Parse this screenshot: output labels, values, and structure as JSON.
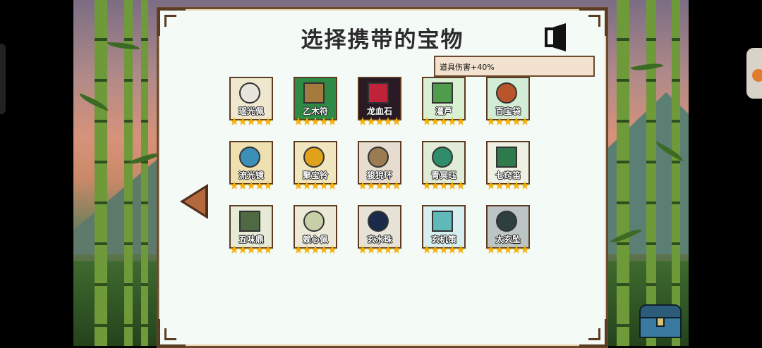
{
  "dialog": {
    "title": "选择携带的宝物",
    "tooltip": "道具伤害+40%"
  },
  "icons": {
    "exit": "exit-door-icon",
    "prev": "arrow-left-icon",
    "chest": "treasure-chest-icon",
    "star": "star-icon"
  },
  "colors": {
    "panel_bg": "#f4faf6",
    "frame": "#5a3c22",
    "star": "#f3b10c",
    "arrow": "#b4683e"
  },
  "items": [
    {
      "name": "瑶光佩",
      "stars": 5,
      "bg": "#efe8cf",
      "art": "#e8e6dc",
      "round": true
    },
    {
      "name": "乙木符",
      "stars": 5,
      "bg": "#2f8a45",
      "art": "#a57a3f",
      "round": false
    },
    {
      "name": "龙血石",
      "stars": 5,
      "bg": "#2a1a26",
      "art": "#c0223a",
      "round": false
    },
    {
      "name": "灌芦",
      "stars": 5,
      "bg": "#d9f0d3",
      "art": "#4f9c4a",
      "round": false
    },
    {
      "name": "百宝袋",
      "stars": 5,
      "bg": "#d3ecd6",
      "art": "#b8552a",
      "round": true
    },
    {
      "name": "流光镜",
      "stars": 5,
      "bg": "#efe0b2",
      "art": "#3c8fb6",
      "round": true
    },
    {
      "name": "聚宝铃",
      "stars": 5,
      "bg": "#f0e6bf",
      "art": "#e0a21a",
      "round": true
    },
    {
      "name": "狻猊环",
      "stars": 5,
      "bg": "#e6ddd0",
      "art": "#9a7b52",
      "round": true
    },
    {
      "name": "青冥珏",
      "stars": 5,
      "bg": "#e0ecd8",
      "art": "#2f8d6a",
      "round": true
    },
    {
      "name": "七窍笛",
      "stars": 5,
      "bg": "#eef0e4",
      "art": "#2e7a4a",
      "round": false
    },
    {
      "name": "五味鼎",
      "stars": 5,
      "bg": "#e6ead6",
      "art": "#4f6a43",
      "round": false
    },
    {
      "name": "赖心佩",
      "stars": 5,
      "bg": "#ece9d8",
      "art": "#c6cfa8",
      "round": true
    },
    {
      "name": "玄水珠",
      "stars": 5,
      "bg": "#e6e2d6",
      "art": "#1a2a4a",
      "round": true
    },
    {
      "name": "玄机策",
      "stars": 5,
      "bg": "#d6eef0",
      "art": "#5fb9b9",
      "round": false
    },
    {
      "name": "太玄坠",
      "stars": 5,
      "bg": "#bcc4c4",
      "art": "#2f3e3e",
      "round": true
    }
  ]
}
